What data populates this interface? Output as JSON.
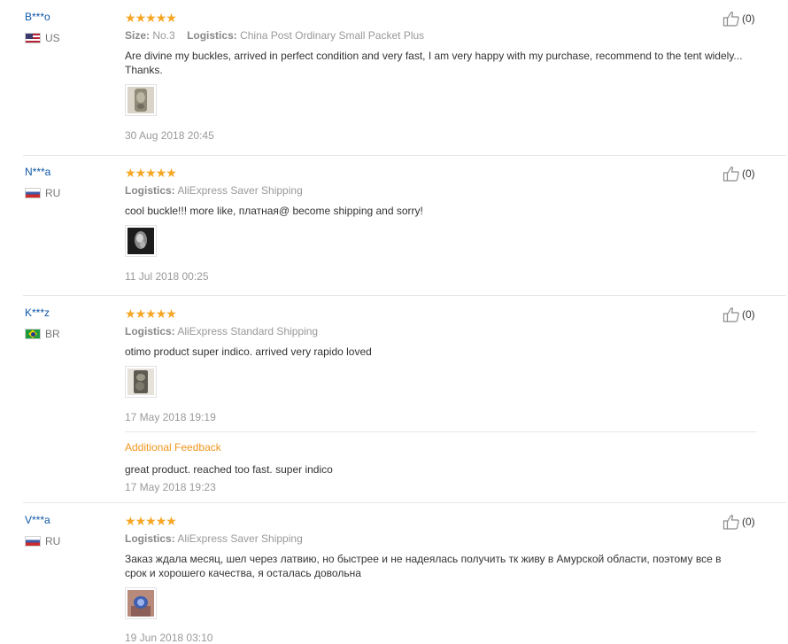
{
  "colors": {
    "star": "#f6a623",
    "username": "#0e57a6",
    "additional_feedback": "#f0961e",
    "muted": "#999999"
  },
  "labels": {
    "size": "Size:",
    "logistics": "Logistics:",
    "additional_feedback": "Additional Feedback"
  },
  "reviews": [
    {
      "user": "B***o",
      "country": "US",
      "flag_icon": "us-flag-icon",
      "rating": 5,
      "size": "No.3",
      "logistics": "China Post Ordinary Small Packet Plus",
      "text": "Are divine my buckles, arrived in perfect condition and very fast, I am very happy with my purchase, recommend to the tent widely... Thanks.",
      "date": "30 Aug 2018 20:45",
      "likes": "(0)"
    },
    {
      "user": "N***a",
      "country": "RU",
      "flag_icon": "ru-flag-icon",
      "rating": 5,
      "logistics": "AliExpress Saver Shipping",
      "text": "cool buckle!!! more like, платная@ become shipping and sorry!",
      "date": "11 Jul 2018 00:25",
      "likes": "(0)"
    },
    {
      "user": "K***z",
      "country": "BR",
      "flag_icon": "br-flag-icon",
      "rating": 5,
      "logistics": "AliExpress Standard Shipping",
      "text": "otimo product super indico. arrived very rapido loved",
      "date": "17 May 2018 19:19",
      "likes": "(0)",
      "additional": {
        "text": "great product. reached too fast. super indico",
        "date": "17 May 2018 19:23"
      }
    },
    {
      "user": "V***a",
      "country": "RU",
      "flag_icon": "ru-flag-icon",
      "rating": 5,
      "logistics": "AliExpress Saver Shipping",
      "text": "Заказ ждала месяц, шел через латвию, но быстрее и не надеялась получить тк живу в Амурской области, поэтому все в срок и хорошего качества, я осталась довольна",
      "date": "19 Jun 2018 03:10",
      "likes": "(0)"
    }
  ]
}
